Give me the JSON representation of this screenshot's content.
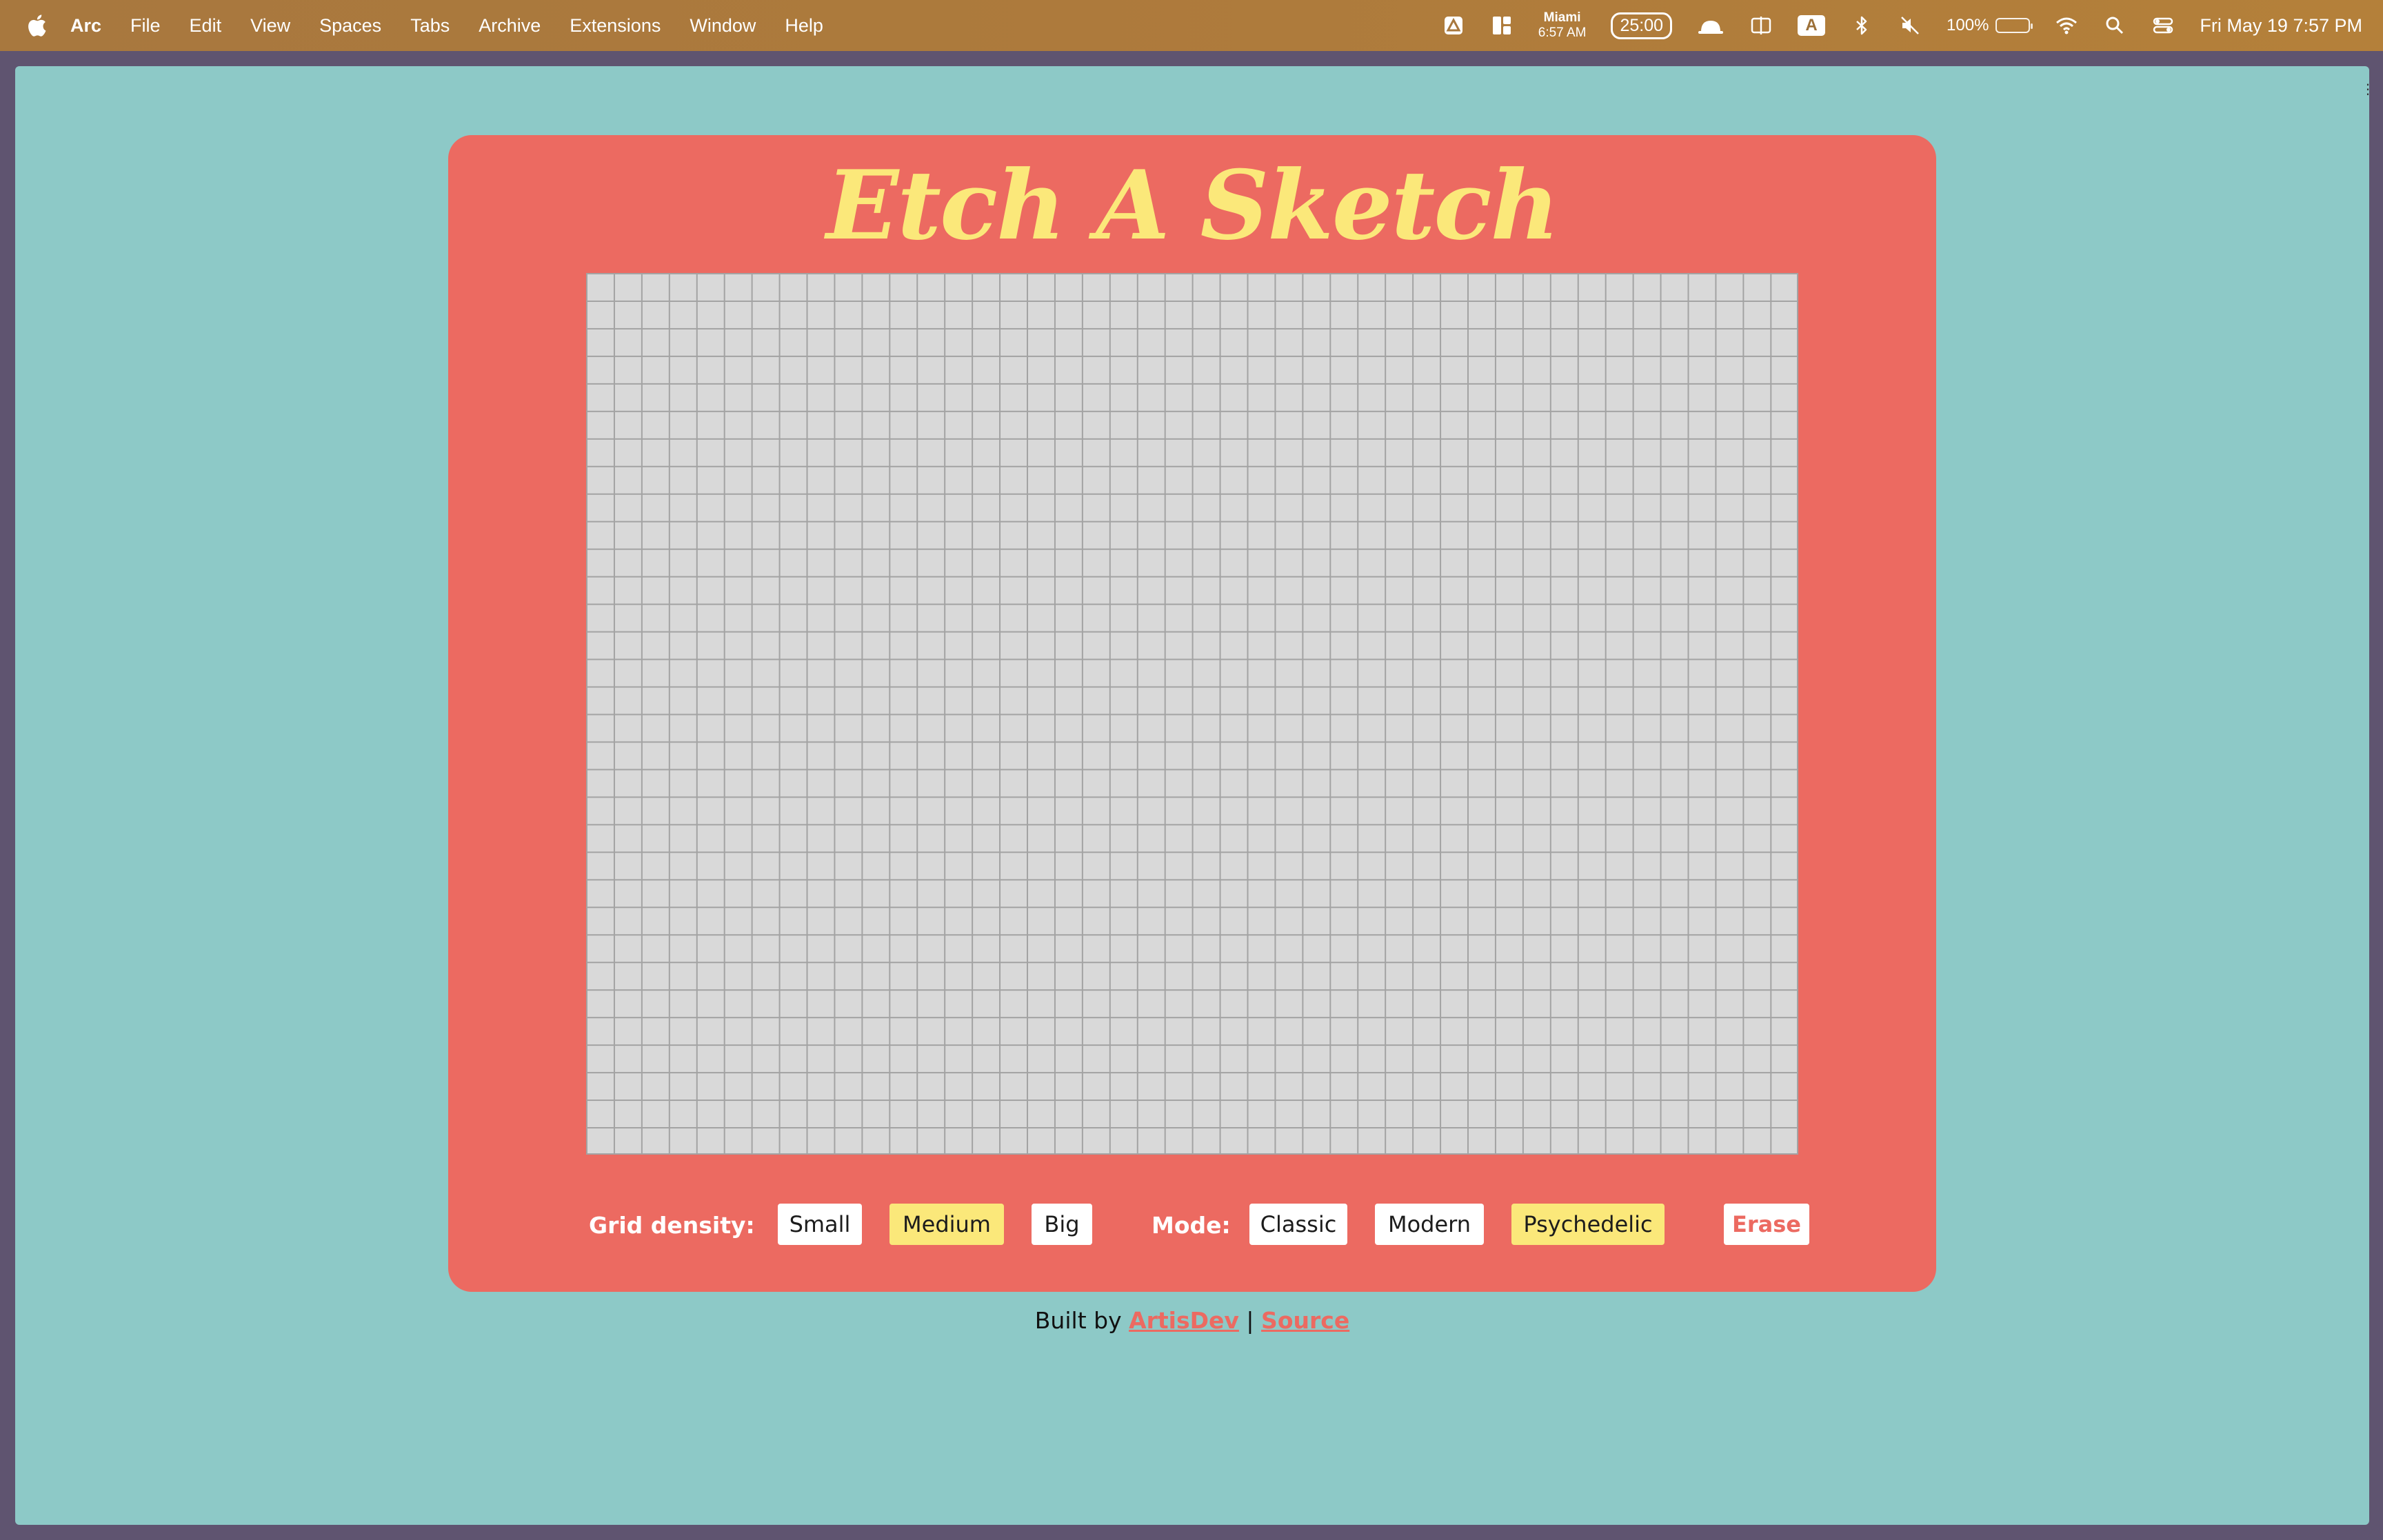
{
  "menubar": {
    "app_name": "Arc",
    "items": [
      "File",
      "Edit",
      "View",
      "Spaces",
      "Tabs",
      "Archive",
      "Extensions",
      "Window",
      "Help"
    ],
    "city": "Miami",
    "city_time": "6:57 AM",
    "timer": "25:00",
    "input_source": "A",
    "battery_percent": "100%",
    "battery_level": 1.0,
    "datetime": "Fri May 19  7:57 PM"
  },
  "app": {
    "title": "Etch A Sketch",
    "grid_density_label": "Grid density:",
    "density_options": [
      "Small",
      "Medium",
      "Big"
    ],
    "density_selected": "Medium",
    "mode_label": "Mode:",
    "mode_options": [
      "Classic",
      "Modern",
      "Psychedelic"
    ],
    "mode_selected": "Psychedelic",
    "erase_label": "Erase"
  },
  "footer": {
    "built_by": "Built by",
    "author_link": "ArtisDev",
    "separator": "|",
    "source_link": "Source"
  },
  "colors": {
    "background": "#8dc9c7",
    "card": "#ec6a61",
    "accent_yellow": "#fbe87a",
    "grid_cell": "#d9d9d9",
    "grid_line": "#a3a3a3"
  }
}
